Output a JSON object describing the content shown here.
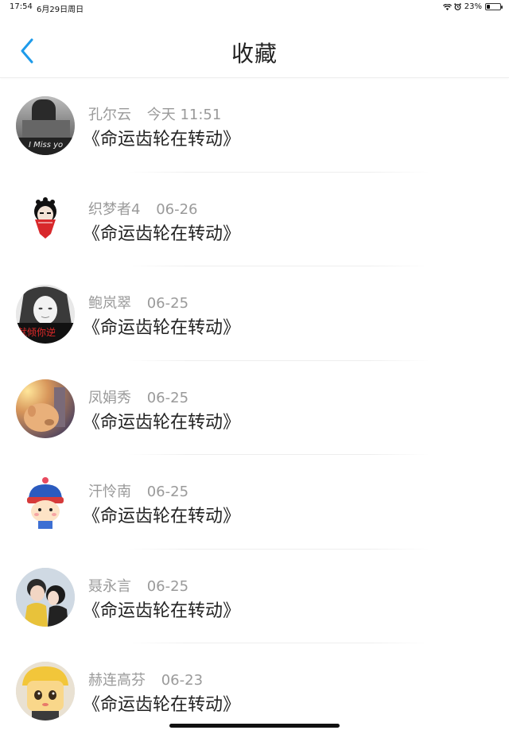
{
  "status_bar": {
    "time": "17:54",
    "date": "6月29日周日",
    "battery": "23%",
    "battery_level": 0.23
  },
  "nav": {
    "title": "收藏"
  },
  "colors": {
    "accent": "#1e9bea",
    "author_text": "#9a9a9a",
    "title_text": "#222222"
  },
  "items": [
    {
      "author": "孔尔云",
      "time": "今天 11:51",
      "title": "《命运齿轮在转动》",
      "avatar_caption": "I Miss yo",
      "avatar": "bw-photo"
    },
    {
      "author": "织梦者4",
      "time": "06-26",
      "title": "《命运齿轮在转动》",
      "avatar": "red-mask-figure"
    },
    {
      "author": "鲍岚翠",
      "time": "06-25",
      "title": "《命运齿轮在转动》",
      "avatar_caption": "就倾你逆",
      "avatar": "girl-photo"
    },
    {
      "author": "凤娟秀",
      "time": "06-25",
      "title": "《命运齿轮在转动》",
      "avatar": "dog-sunset"
    },
    {
      "author": "汗怜南",
      "time": "06-25",
      "title": "《命运齿轮在转动》",
      "avatar": "cartoon-boy"
    },
    {
      "author": "聂永言",
      "time": "06-25",
      "title": "《命运齿轮在转动》",
      "avatar": "couple-photo"
    },
    {
      "author": "赫连高芬",
      "time": "06-23",
      "title": "《命运齿轮在转动》",
      "avatar": "yellow-toy"
    }
  ]
}
